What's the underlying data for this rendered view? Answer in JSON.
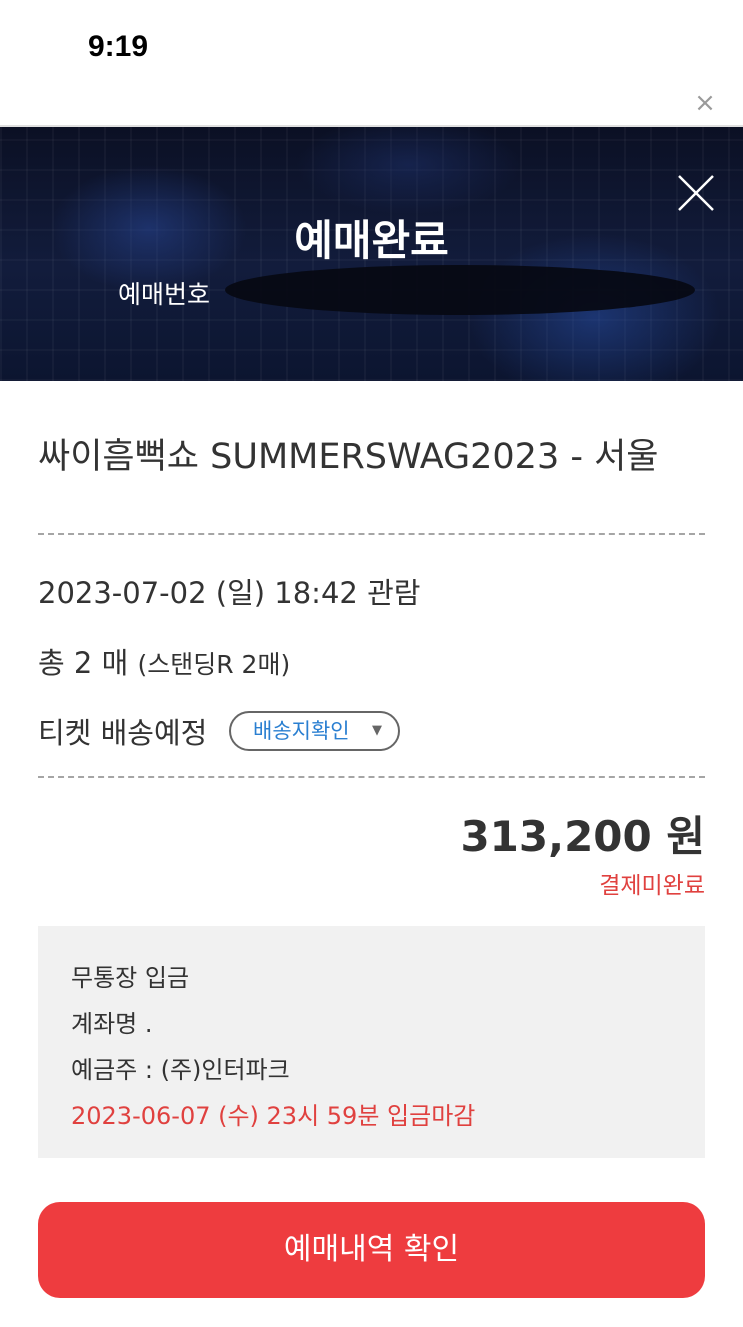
{
  "status_bar": {
    "time": "9:19"
  },
  "header": {
    "title": "예매완료",
    "booking_number_label": "예매번호"
  },
  "event": {
    "title": "싸이흠뻑쇼 SUMMERSWAG2023 - 서울",
    "date_time": "2023-07-02 (일) 18:42 관람",
    "ticket_count": "총 2 매",
    "ticket_detail": "(스탠딩R 2매)",
    "shipping_label": "티켓 배송예정",
    "shipping_button": "배송지확인"
  },
  "payment": {
    "amount": "313,200 원",
    "status": "결제미완료"
  },
  "deposit": {
    "method": "무통장 입금",
    "account_label": "계좌명 .",
    "account_holder": "예금주 : (주)인터파크",
    "deadline": "2023-06-07 (수) 23시 59분 입금마감"
  },
  "actions": {
    "confirm_label": "예매내역 확인"
  },
  "colors": {
    "accent_red": "#ee3c3f",
    "link_blue": "#2a7fd1",
    "header_dark": "#0e1630"
  },
  "icons": {
    "close": "close-icon",
    "dropdown": "caret-down-icon"
  }
}
